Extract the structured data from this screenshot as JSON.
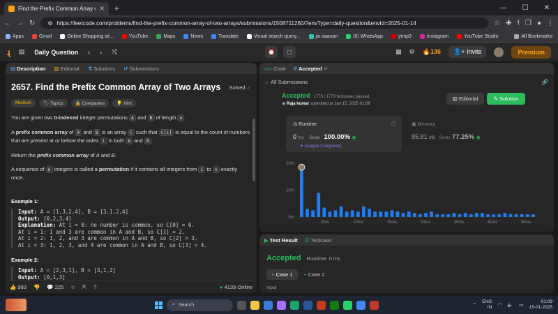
{
  "browser": {
    "tab_title": "Find the Prefix Common Array of...",
    "url": "https://leetcode.com/problems/find-the-prefix-common-array-of-two-arrays/submissions/1508711260/?envType=daily-question&envId=2025-01-14",
    "bookmarks": [
      "Apps",
      "Gmail",
      "Online Shopping sit...",
      "YouTube",
      "Maps",
      "News",
      "Translate",
      "Visual search query...",
      "jio saavan",
      "(6) WhatsApp",
      "ytmp3",
      "Instagram",
      "YouTube Studio"
    ],
    "all_bookmarks": "All Bookmarks"
  },
  "topbar": {
    "logo": "ɻ",
    "daily": "Daily Question",
    "streak": "136",
    "invite": "Invite",
    "premium": "Premium"
  },
  "left": {
    "tabs": [
      "Description",
      "Editorial",
      "Solutions",
      "Submissions"
    ],
    "title": "2657. Find the Prefix Common Array of Two Arrays",
    "solved": "Solved",
    "tags": [
      "Medium",
      "Topics",
      "Companies",
      "Hint"
    ],
    "p1a": "You are given two ",
    "p1b": "0-indexed",
    "p1c": " integer permutations ",
    "p1d": " and ",
    "p1e": " of length ",
    "A": "A",
    "B": "B",
    "n": "n",
    "C": "C",
    "Ci": "C[i]",
    "i": "i",
    "one": "1",
    "p2a": "A ",
    "p2b": "prefix common array",
    "p2c": " of ",
    "p2d": " and ",
    "p2e": " is an array ",
    "p2f": " such that ",
    "p2g": " is equal to the count of numbers that are present at or before the index ",
    "p2h": " in both ",
    "p2i": " and ",
    "p3a": "Return the ",
    "p3b": "prefix common array",
    "p3c": " of ",
    "p3d": " and ",
    "p4a": "A sequence of ",
    "p4b": " integers is called a ",
    "p4c": "permutation",
    "p4d": " if it contains all integers from ",
    "p4e": " to ",
    "p4f": " exactly once.",
    "ex1": "Example 1:",
    "ex1_input_l": "Input:",
    "ex1_input": " A = [1,3,2,4], B = [3,1,2,4]",
    "ex1_output_l": "Output:",
    "ex1_output": " [0,2,3,4]",
    "ex1_expl_l": "Explanation:",
    "ex1_expl": " At i = 0: no number is common, so C[0] = 0.\nAt i = 1: 1 and 3 are common in A and B, so C[1] = 2.\nAt i = 2: 1, 2, and 3 are common in A and B, so C[2] = 3.\nAt i = 3: 1, 2, 3, and 4 are common in A and B, so C[3] = 4.",
    "ex2": "Example 2:",
    "ex2_input_l": "Input:",
    "ex2_input": " A = [2,3,1], B = [3,1,2]",
    "ex2_output_l": "Output:",
    "ex2_output": " [0,1,3]",
    "likes": "983",
    "comments": "225",
    "online": "4139 Online"
  },
  "right": {
    "tabs": [
      "Code",
      "Accepted"
    ],
    "back": "All Submissions",
    "status": "Accepted",
    "passed": "1773 / 1773 testcases passed",
    "user": "Raja kumar",
    "submitted": " submitted at Jan 15, 2025 01:08",
    "editorial": "Editorial",
    "solution": "Solution",
    "runtime_label": "Runtime",
    "runtime_value": "0",
    "runtime_unit": "ms",
    "beats_label": "Beats",
    "runtime_beats": "100.00%",
    "analyze": "Analyze Complexity",
    "memory_label": "Memory",
    "memory_value": "85.81",
    "memory_unit": "MB",
    "memory_beats": "77.25%"
  },
  "chart_data": {
    "type": "bar",
    "y_ticks": [
      "20%",
      "10%",
      "0%"
    ],
    "ylim": [
      0,
      20
    ],
    "x_ticks": [
      "5ms",
      "10ms",
      "15ms",
      "20ms",
      "25ms",
      "31ms",
      "36ms"
    ],
    "values": [
      18,
      3,
      2.5,
      9,
      3.5,
      2,
      2.5,
      4,
      2,
      2.5,
      2,
      4,
      3,
      2,
      2,
      2,
      2.5,
      2,
      1.5,
      2,
      1.5,
      1,
      1.5,
      2,
      1,
      1,
      1,
      1.5,
      1,
      1.5,
      1,
      1.5,
      1.5,
      1,
      1,
      1,
      1.5,
      1,
      1,
      1,
      1,
      1
    ],
    "highlight_index": 0,
    "color": "#1e7ef2"
  },
  "bottom": {
    "tabs": [
      "Test Result",
      "Testcase"
    ],
    "status": "Accepted",
    "runtime": "Runtime: 0 ms",
    "case1": "Case 1",
    "case2": "Case 2",
    "input": "Input"
  },
  "taskbar": {
    "search": "Search",
    "lang1": "ENG",
    "lang2": "IN",
    "time": "01:09",
    "date": "15-01-2025"
  }
}
